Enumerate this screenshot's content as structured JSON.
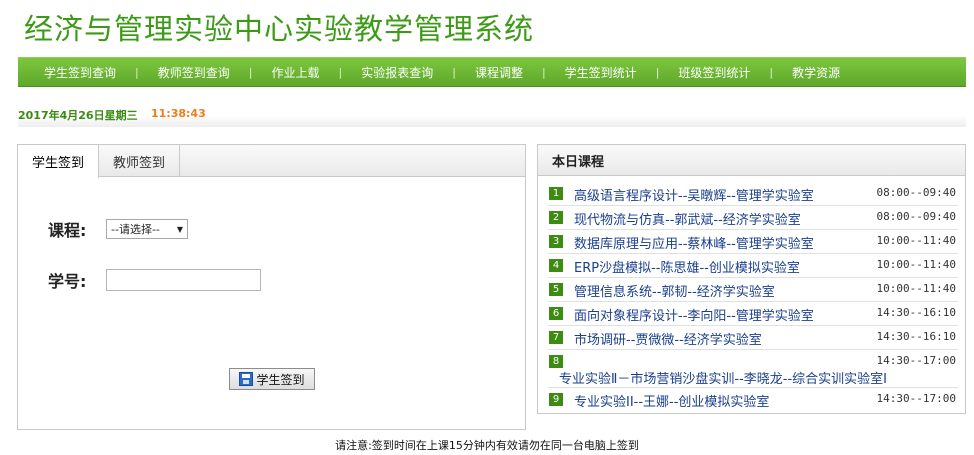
{
  "site": {
    "title": "经济与管理实验中心实验教学管理系统"
  },
  "nav": {
    "items": [
      "学生签到查询",
      "教师签到查询",
      "作业上载",
      "实验报表查询",
      "课程调整",
      "学生签到统计",
      "班级签到统计",
      "教学资源"
    ],
    "separator": "|"
  },
  "datebar": {
    "date": "2017年4月26日星期三",
    "time": "11:38:43"
  },
  "signin": {
    "tabs": [
      "学生签到",
      "教师签到"
    ],
    "active_tab": "学生签到",
    "course_label": "课程:",
    "course_select": "--请选择--",
    "student_id_label": "学号:",
    "student_id_value": "",
    "submit_label": "学生签到"
  },
  "today": {
    "title": "本日课程",
    "courses": [
      {
        "no": "1",
        "title": "高级语言程序设计--吴暾辉--管理学实验室",
        "time": "08:00--09:40"
      },
      {
        "no": "2",
        "title": "现代物流与仿真--郭武斌--经济学实验室",
        "time": "08:00--09:40"
      },
      {
        "no": "3",
        "title": "数据库原理与应用--蔡林峰--管理学实验室",
        "time": "10:00--11:40"
      },
      {
        "no": "4",
        "title": "ERP沙盘模拟--陈思雄--创业模拟实验室",
        "time": "10:00--11:40"
      },
      {
        "no": "5",
        "title": "管理信息系统--郭韧--经济学实验室",
        "time": "10:00--11:40"
      },
      {
        "no": "6",
        "title": "面向对象程序设计--李向阳--管理学实验室",
        "time": "14:30--16:10"
      },
      {
        "no": "7",
        "title": "市场调研--贾微微--经济学实验室",
        "time": "14:30--16:10"
      },
      {
        "no": "8",
        "title": "专业实验Ⅱ－市场营销沙盘实训--李晓龙--综合实训实验室Ⅰ",
        "time": "14:30--17:00"
      },
      {
        "no": "9",
        "title": "专业实验II--王娜--创业模拟实验室",
        "time": "14:30--17:00"
      }
    ]
  },
  "notice": "请注意:签到时间在上课15分钟内有效请勿在同一台电脑上签到",
  "colors": {
    "brand_green": "#3d9a16",
    "nav_green": "#6cb833",
    "time_orange": "#f07d17",
    "link_blue": "#1a3f8c"
  }
}
